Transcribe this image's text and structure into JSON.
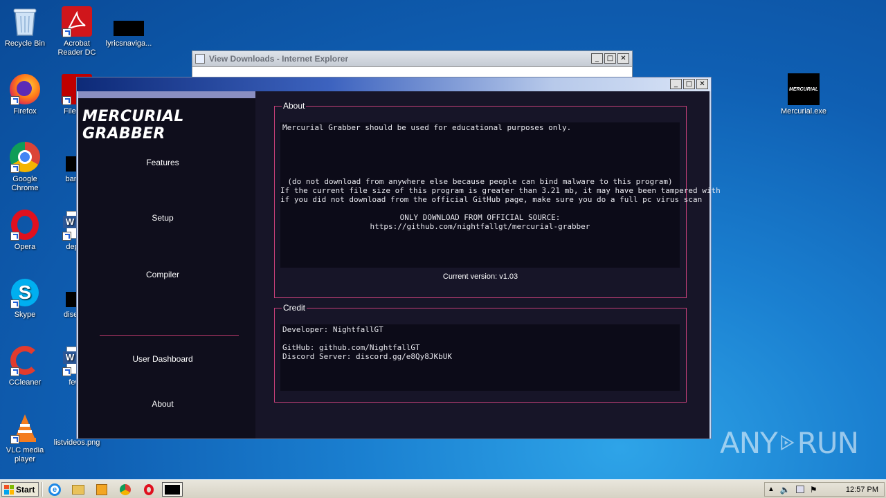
{
  "desktop": {
    "icons": [
      {
        "label": "Recycle Bin"
      },
      {
        "label": "Acrobat Reader DC"
      },
      {
        "label": "lyricsnaviga..."
      },
      {
        "label": "Firefox"
      },
      {
        "label": "FileZilla"
      },
      {
        "label": "Google Chrome"
      },
      {
        "label": "bankm"
      },
      {
        "label": "Opera"
      },
      {
        "label": "depart"
      },
      {
        "label": "Skype"
      },
      {
        "label": "disease"
      },
      {
        "label": "CCleaner"
      },
      {
        "label": "fewn"
      },
      {
        "label": "VLC media player"
      },
      {
        "label": "listvideos.png"
      },
      {
        "label": "Mercurial.exe"
      }
    ],
    "mercurial_icon_text": "MERCURIAL"
  },
  "ie_window": {
    "title": "View Downloads - Internet Explorer"
  },
  "window_buttons": {
    "minimize": "_",
    "maximize": "□",
    "close": "✕"
  },
  "mercurial": {
    "brand": "MERCURIAL GRABBER",
    "nav": {
      "features": "Features",
      "setup": "Setup",
      "compiler": "Compiler",
      "user_dashboard": "User Dashboard",
      "about": "About"
    },
    "about_group": {
      "title": "About",
      "line1": "Mercurial Grabber should be used for educational purposes only.",
      "warning1": "(do not download from anywhere else because people can bind malware to this program)",
      "warning2": "If the current file size of this program is greater than 3.21 mb, it may have been tampered with",
      "warning3": "if you did not download from the official GitHub page, make sure you do a full pc virus scan",
      "source_heading": "ONLY DOWNLOAD FROM OFFICIAL SOURCE:",
      "source_url": "https://github.com/nightfallgt/mercurial-grabber",
      "version": "Current version: v1.03"
    },
    "credit_group": {
      "title": "Credit",
      "developer": "Developer: NightfallGT",
      "github": "GitHub: github.com/NightfallGT",
      "discord": "Discord Server: discord.gg/e8Qy8JKbUK"
    }
  },
  "watermark": {
    "left": "ANY",
    "right": "RUN"
  },
  "taskbar": {
    "start_label": "Start",
    "clock": "12:57 PM"
  },
  "colors": {
    "accent_pink": "#c8407a",
    "window_bg": "#171528",
    "sidebar_bg": "#0f0e1c"
  }
}
